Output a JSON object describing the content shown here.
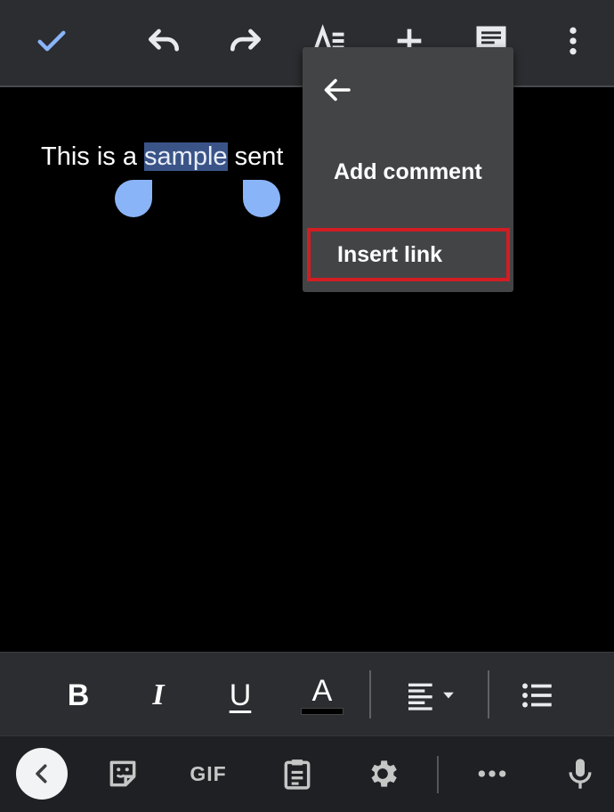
{
  "colors": {
    "accent": "#8ab4f8",
    "toolbar_bg": "#2c2d30",
    "menu_bg": "#434446",
    "highlight_box": "#d21d23",
    "selection_bg": "#3a5488"
  },
  "toolbar": {
    "icons": [
      "check-icon",
      "undo-icon",
      "redo-icon",
      "text-format-icon",
      "add-icon",
      "comment-icon",
      "more-vert-icon"
    ]
  },
  "document": {
    "before": "This is a ",
    "selected": "sample",
    "after": " sent"
  },
  "context_menu": {
    "back_icon": "arrow-back-icon",
    "items": [
      {
        "label": "Add comment"
      },
      {
        "label": "Insert link"
      }
    ]
  },
  "format_bar": {
    "bold": "B",
    "italic": "I",
    "underline": "U",
    "text_color": "A",
    "icons": [
      "align-left-icon",
      "bulleted-list-icon"
    ]
  },
  "keyboard_bar": {
    "gif": "GIF",
    "icons": [
      "chevron-left-icon",
      "sticker-icon",
      "clipboard-icon",
      "settings-icon",
      "more-horiz-icon",
      "mic-icon"
    ]
  }
}
